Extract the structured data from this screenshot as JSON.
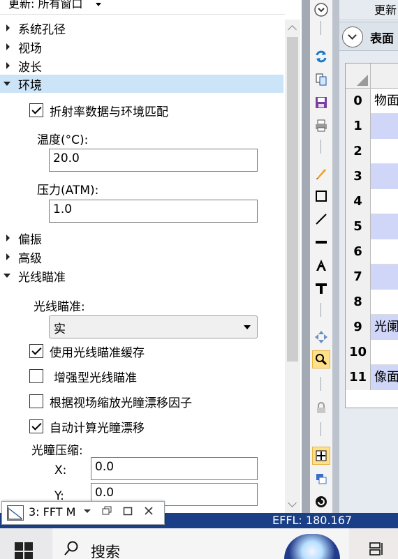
{
  "left_panel": {
    "update_label": "更新: 所有窗口",
    "tree": [
      {
        "label": "系统孔径",
        "expanded": false
      },
      {
        "label": "视场",
        "expanded": false
      },
      {
        "label": "波长",
        "expanded": false
      },
      {
        "label": "环境",
        "expanded": true,
        "selected": true
      },
      {
        "label": "偏振",
        "expanded": false
      },
      {
        "label": "高级",
        "expanded": false
      },
      {
        "label": "光线瞄准",
        "expanded": true
      }
    ],
    "environment": {
      "match_index_checkbox": {
        "label": "折射率数据与环境匹配",
        "checked": true
      },
      "temperature_label": "温度(°C):",
      "temperature_value": "20.0",
      "pressure_label": "压力(ATM):",
      "pressure_value": "1.0"
    },
    "ray_aiming": {
      "label": "光线瞄准:",
      "selected": "实",
      "options": [
        {
          "label": "使用光线瞄准缓存",
          "checked": true
        },
        {
          "label": "增强型光线瞄准",
          "checked": false
        },
        {
          "label": "根据视场缩放光瞳漂移因子",
          "checked": false
        },
        {
          "label": "自动计算光瞳漂移",
          "checked": true
        }
      ],
      "compress_label": "光瞳压缩:",
      "x_label": "X:",
      "x_value": "0.0",
      "y_label": "Y:",
      "y_value": "0.0"
    }
  },
  "toolbar": {
    "icons": [
      "collapse-icon",
      "refresh-icon",
      "copy-icon",
      "save-icon",
      "print-icon",
      "pen-icon",
      "rectangle-icon",
      "line-icon",
      "thick-line-icon",
      "text-icon",
      "text-bar-icon",
      "move-icon",
      "zoom-icon",
      "lock-icon",
      "fit-icon",
      "window-icon",
      "spiral-icon"
    ]
  },
  "right_panel": {
    "update_label": "更新",
    "section_title": "表面",
    "rows": [
      {
        "num": "0",
        "text": "物面"
      },
      {
        "num": "1",
        "text": ""
      },
      {
        "num": "2",
        "text": ""
      },
      {
        "num": "3",
        "text": ""
      },
      {
        "num": "4",
        "text": ""
      },
      {
        "num": "5",
        "text": ""
      },
      {
        "num": "6",
        "text": ""
      },
      {
        "num": "7",
        "text": ""
      },
      {
        "num": "8",
        "text": ""
      },
      {
        "num": "9",
        "text": "光阑"
      },
      {
        "num": "10",
        "text": ""
      },
      {
        "num": "11",
        "text": "像面"
      }
    ]
  },
  "status_bar": {
    "effl": "EFFL: 180.167"
  },
  "window_tab": {
    "label": "3: FFT M"
  },
  "taskbar": {
    "search_placeholder": "搜索"
  }
}
